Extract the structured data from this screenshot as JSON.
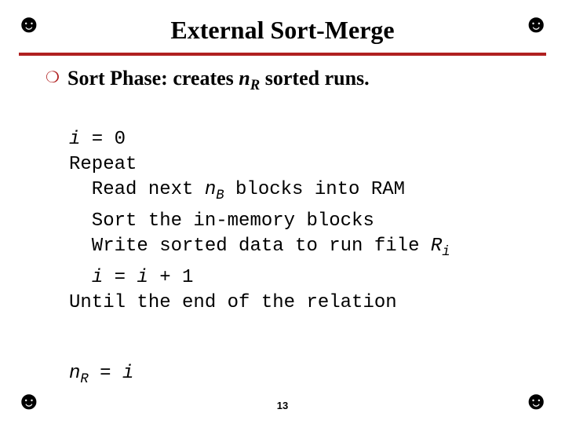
{
  "corner_glyph": "☻",
  "title": "External Sort-Merge",
  "bullet": {
    "glyph": "❍",
    "prefix": "Sort Phase: creates ",
    "n": "n",
    "sub": "R",
    "suffix": " sorted runs."
  },
  "code": {
    "l1_a": "i",
    "l1_b": " = 0",
    "l2": "Repeat",
    "l3_a": "  Read next ",
    "l3_n": "n",
    "l3_sub": "B",
    "l3_b": " blocks into RAM",
    "l4": "  Sort the in-memory blocks",
    "l5_a": "  Write sorted data to run file ",
    "l5_r": "R",
    "l5_sub": "i",
    "l6_a": "  ",
    "l6_i1": "i",
    "l6_b": " = ",
    "l6_i2": "i",
    "l6_c": " + 1",
    "l7": "Until the end of the relation",
    "l8_n": "n",
    "l8_sub": "R",
    "l8_b": " = ",
    "l8_i": "i"
  },
  "page_number": "13"
}
